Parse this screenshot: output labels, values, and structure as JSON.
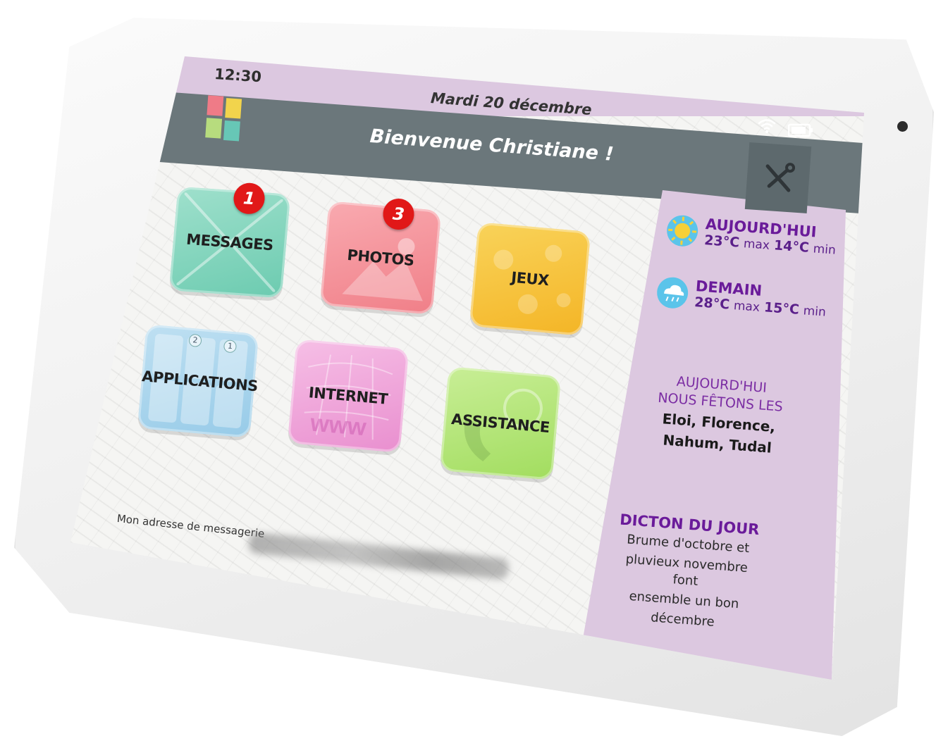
{
  "status": {
    "time": "12:30",
    "date": "Mardi 20 décembre"
  },
  "header": {
    "welcome": "Bienvenue Christiane !"
  },
  "tiles": [
    {
      "label": "MESSAGES",
      "badge": "1"
    },
    {
      "label": "PHOTOS",
      "badge": "3"
    },
    {
      "label": "JEUX"
    },
    {
      "label": "APPLICATIONS",
      "mini_badges": [
        "2",
        "1"
      ]
    },
    {
      "label": "INTERNET"
    },
    {
      "label": "ASSISTANCE"
    }
  ],
  "weather": {
    "today": {
      "title": "AUJOURD'HUI",
      "max": "23°C",
      "max_unit": "max",
      "min": "14°C",
      "min_unit": "min",
      "icon": "sun-icon"
    },
    "tomorrow": {
      "title": "DEMAIN",
      "max": "28°C",
      "max_unit": "max",
      "min": "15°C",
      "min_unit": "min",
      "icon": "rain-cloud-icon"
    }
  },
  "feast": {
    "line1": "AUJOURD'HUI",
    "line2": "NOUS FÊTONS LES",
    "names1": "Eloi, Florence,",
    "names2": "Nahum, Tudal"
  },
  "dicton": {
    "title": "DICTON DU JOUR",
    "lines": [
      "Brume d'octobre et",
      "pluvieux novembre font",
      "ensemble un bon",
      "décembre"
    ]
  },
  "footer": {
    "email_label": "Mon adresse de messagerie"
  },
  "colors": {
    "header_bar": "#6b777b",
    "panel": "#dcc8e0",
    "accent_purple": "#6a1b9a",
    "badge_red": "#e11818"
  }
}
